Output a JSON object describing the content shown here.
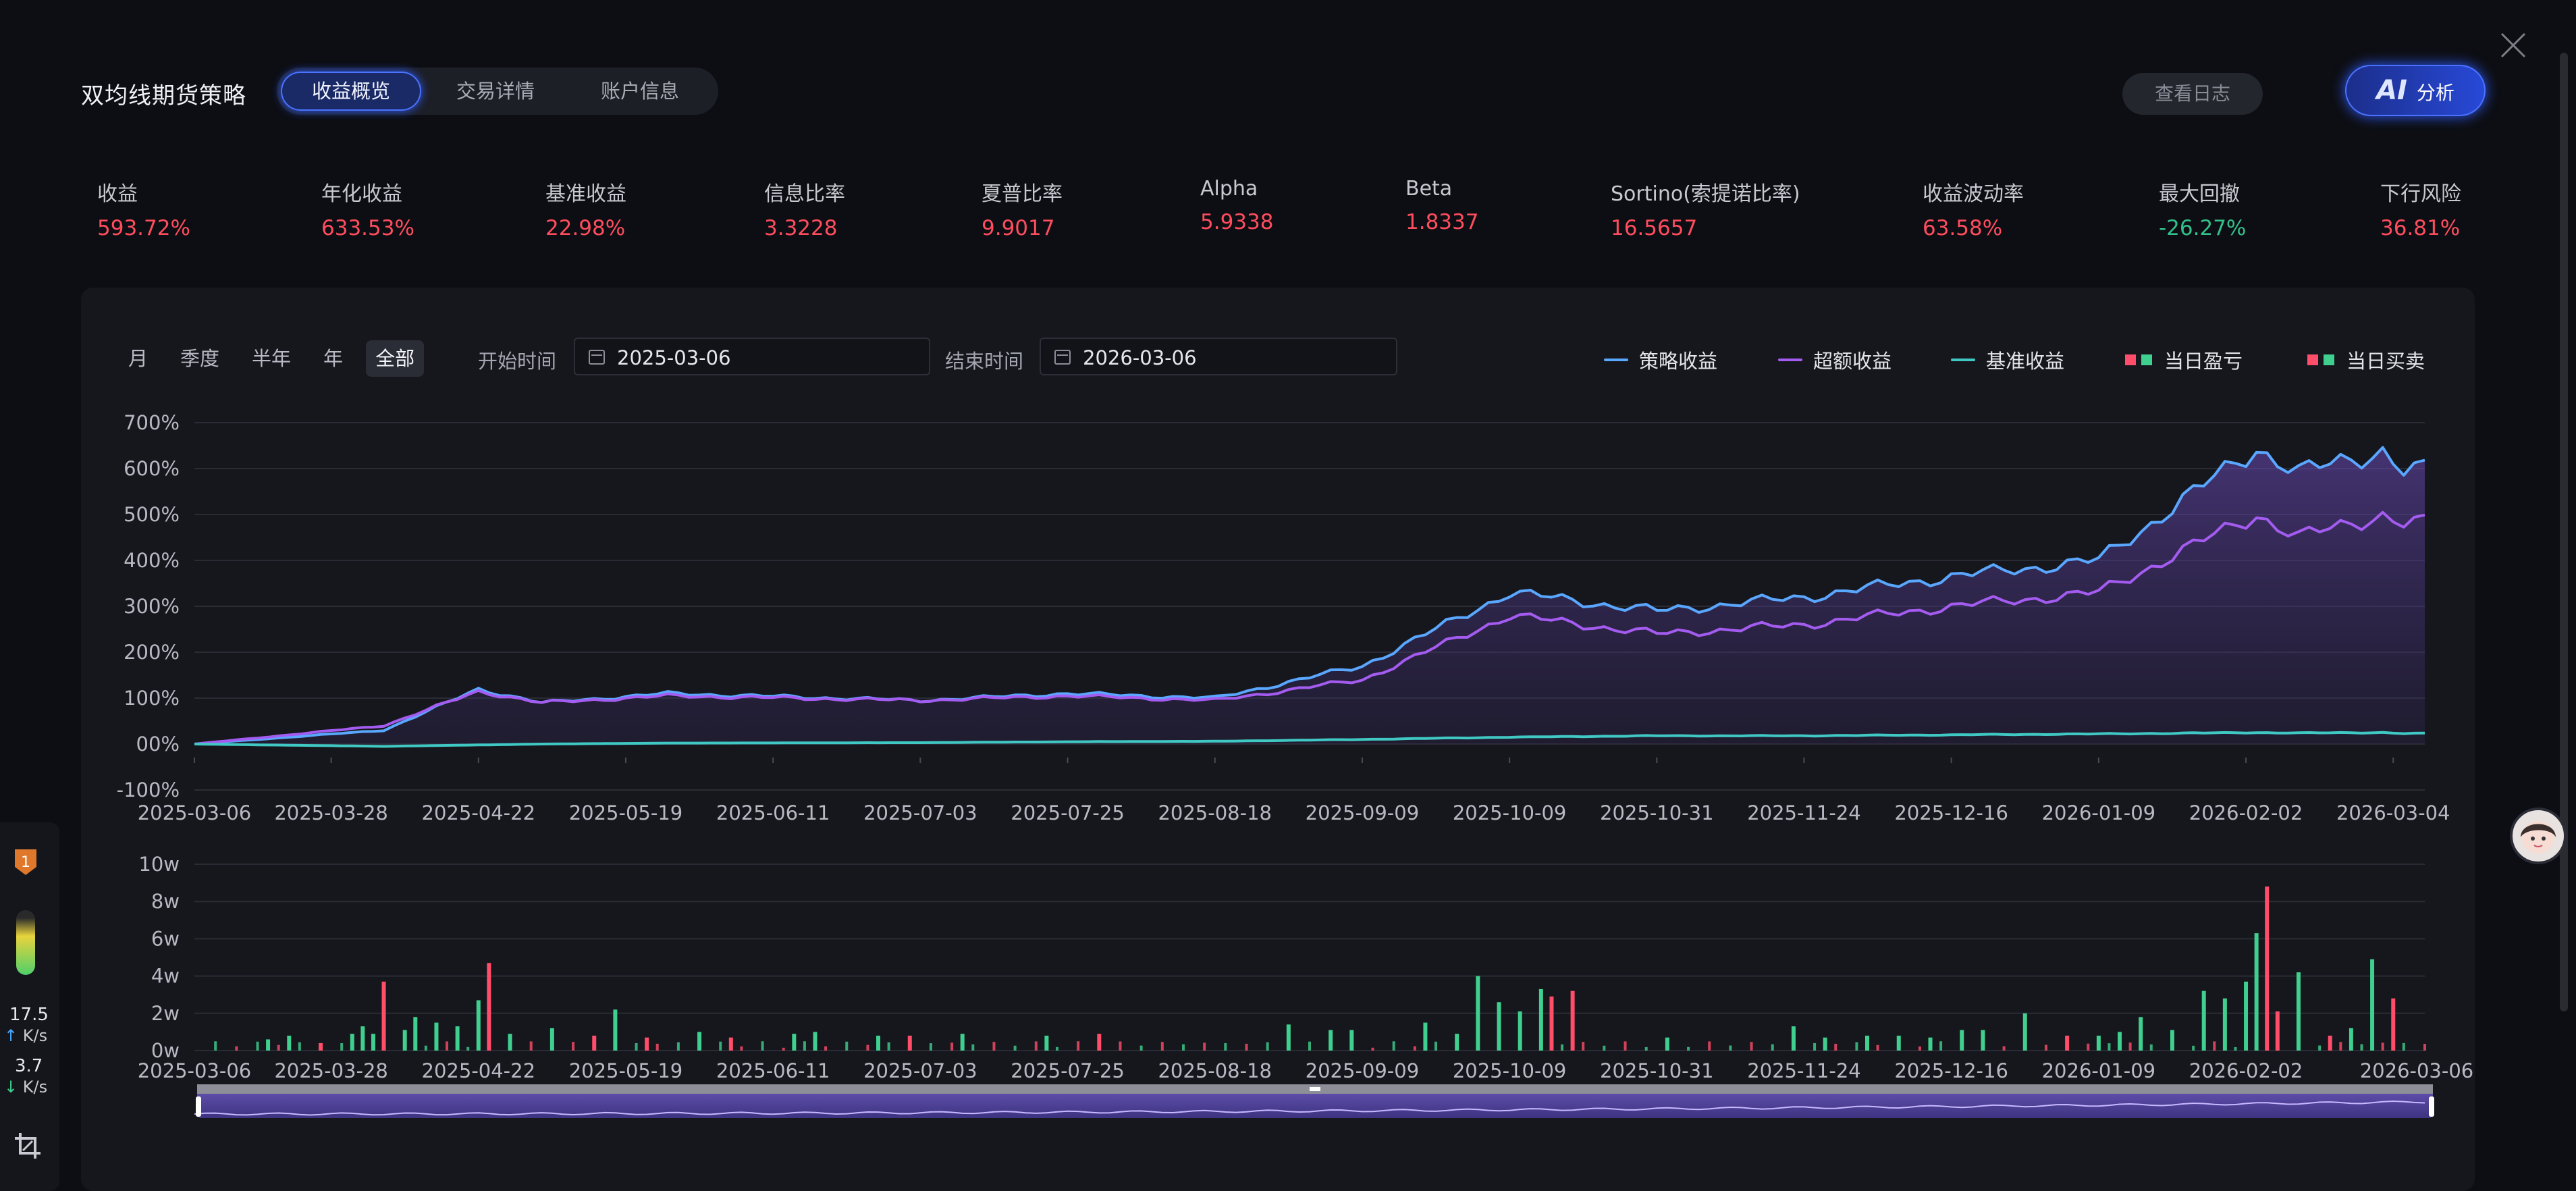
{
  "header": {
    "title": "双均线期货策略",
    "tabs": [
      {
        "label": "收益概览",
        "active": true
      },
      {
        "label": "交易详情",
        "active": false
      },
      {
        "label": "账户信息",
        "active": false
      }
    ],
    "log_button": "查看日志",
    "ai_button": {
      "icon_text": "AI",
      "label": "分析"
    }
  },
  "metrics": [
    {
      "label": "收益",
      "value": "593.72%"
    },
    {
      "label": "年化收益",
      "value": "633.53%"
    },
    {
      "label": "基准收益",
      "value": "22.98%"
    },
    {
      "label": "信息比率",
      "value": "3.3228"
    },
    {
      "label": "夏普比率",
      "value": "9.9017"
    },
    {
      "label": "Alpha",
      "value": "5.9338"
    },
    {
      "label": "Beta",
      "value": "1.8337"
    },
    {
      "label": "Sortino(索提诺比率)",
      "value": "16.5657"
    },
    {
      "label": "收益波动率",
      "value": "63.58%"
    },
    {
      "label": "最大回撤",
      "value": "-26.27%"
    },
    {
      "label": "下行风险",
      "value": "36.81%"
    }
  ],
  "filters": {
    "periods": [
      {
        "label": "月",
        "active": false
      },
      {
        "label": "季度",
        "active": false
      },
      {
        "label": "半年",
        "active": false
      },
      {
        "label": "年",
        "active": false
      },
      {
        "label": "全部",
        "active": true
      }
    ],
    "start_label": "开始时间",
    "start_value": "2025-03-06",
    "end_label": "结束时间",
    "end_value": "2026-03-06"
  },
  "legend": [
    {
      "label": "策略收益",
      "kind": "line",
      "color": "#5aa7ff"
    },
    {
      "label": "超额收益",
      "kind": "line",
      "color": "#a45cf0"
    },
    {
      "label": "基准收益",
      "kind": "line",
      "color": "#40c9c4"
    },
    {
      "label": "当日盈亏",
      "kind": "squares",
      "colors": [
        "#ff4d6a",
        "#3fcf8e"
      ]
    },
    {
      "label": "当日买卖",
      "kind": "squares",
      "colors": [
        "#ff4d6a",
        "#3fcf8e"
      ]
    }
  ],
  "sidebar": {
    "badge": "1",
    "upload_speed": "17.5",
    "download_speed": "3.7",
    "speed_unit": "K/s"
  },
  "chart_data": [
    {
      "type": "line",
      "yunit": "%",
      "ylim": [
        -100,
        700
      ],
      "yticks": [
        "700%",
        "600%",
        "500%",
        "400%",
        "300%",
        "200%",
        "100%",
        "00%",
        "-100%"
      ],
      "xticks": [
        "2025-03-06",
        "2025-03-28",
        "2025-04-22",
        "2025-05-19",
        "2025-06-11",
        "2025-07-03",
        "2025-07-25",
        "2025-08-18",
        "2025-09-09",
        "2025-10-09",
        "2025-10-31",
        "2025-11-24",
        "2025-12-16",
        "2026-01-09",
        "2026-02-02",
        "2026-03-04"
      ],
      "x_index": [
        0,
        13,
        27,
        41,
        55,
        69,
        83,
        97,
        111,
        125,
        139,
        153,
        167,
        181,
        195,
        209,
        212
      ],
      "series": [
        {
          "name": "策略收益",
          "color": "#5aa7ff",
          "values": [
            0,
            30,
            120,
            90,
            110,
            95,
            110,
            100,
            170,
            330,
            290,
            320,
            365,
            400,
            645,
            590,
            640,
            595,
            595
          ]
        },
        {
          "name": "超额收益",
          "color": "#a45cf0",
          "values": [
            0,
            40,
            115,
            90,
            105,
            95,
            105,
            95,
            140,
            280,
            240,
            260,
            300,
            330,
            500,
            450,
            500,
            480,
            480
          ]
        },
        {
          "name": "基准收益",
          "color": "#40c9c4",
          "values": [
            0,
            -5,
            -2,
            0,
            2,
            3,
            5,
            6,
            10,
            15,
            18,
            18,
            20,
            22,
            25,
            24,
            25,
            23,
            23
          ]
        }
      ],
      "series_x": [
        0,
        18,
        27,
        33,
        45,
        69,
        83,
        97,
        111,
        125,
        139,
        153,
        167,
        181,
        196,
        200,
        208,
        210,
        212
      ]
    },
    {
      "type": "bar",
      "yticks": [
        "10w",
        "8w",
        "6w",
        "4w",
        "2w",
        "0w"
      ],
      "ylim": [
        0,
        10
      ],
      "xticks": [
        "2025-03-06",
        "2025-03-28",
        "2025-04-22",
        "2025-05-19",
        "2025-06-11",
        "2025-07-03",
        "2025-07-25",
        "2025-08-18",
        "2025-09-09",
        "2025-10-09",
        "2025-10-31",
        "2025-11-24",
        "2025-12-16",
        "2026-01-09",
        "2026-02-02",
        "2026-03-06"
      ],
      "bars": [
        {
          "i": 7,
          "v": 0.6,
          "s": "g"
        },
        {
          "i": 9,
          "v": 0.8,
          "s": "g"
        },
        {
          "i": 12,
          "v": 0.4,
          "s": "r"
        },
        {
          "i": 15,
          "v": 0.9,
          "s": "g"
        },
        {
          "i": 16,
          "v": 1.3,
          "s": "g"
        },
        {
          "i": 17,
          "v": 0.9,
          "s": "g"
        },
        {
          "i": 18,
          "v": 3.7,
          "s": "r"
        },
        {
          "i": 20,
          "v": 1.1,
          "s": "g"
        },
        {
          "i": 21,
          "v": 1.8,
          "s": "g"
        },
        {
          "i": 23,
          "v": 1.5,
          "s": "g"
        },
        {
          "i": 25,
          "v": 1.3,
          "s": "g"
        },
        {
          "i": 27,
          "v": 2.7,
          "s": "g"
        },
        {
          "i": 28,
          "v": 4.7,
          "s": "r"
        },
        {
          "i": 30,
          "v": 0.9,
          "s": "g"
        },
        {
          "i": 34,
          "v": 1.2,
          "s": "g"
        },
        {
          "i": 38,
          "v": 0.8,
          "s": "r"
        },
        {
          "i": 40,
          "v": 2.2,
          "s": "g"
        },
        {
          "i": 43,
          "v": 0.7,
          "s": "r"
        },
        {
          "i": 48,
          "v": 1.0,
          "s": "g"
        },
        {
          "i": 51,
          "v": 0.7,
          "s": "r"
        },
        {
          "i": 57,
          "v": 0.9,
          "s": "g"
        },
        {
          "i": 59,
          "v": 1.0,
          "s": "g"
        },
        {
          "i": 65,
          "v": 0.8,
          "s": "g"
        },
        {
          "i": 68,
          "v": 0.8,
          "s": "r"
        },
        {
          "i": 73,
          "v": 0.9,
          "s": "g"
        },
        {
          "i": 81,
          "v": 0.8,
          "s": "g"
        },
        {
          "i": 86,
          "v": 0.9,
          "s": "r"
        },
        {
          "i": 104,
          "v": 1.4,
          "s": "g"
        },
        {
          "i": 108,
          "v": 1.1,
          "s": "g"
        },
        {
          "i": 110,
          "v": 1.1,
          "s": "g"
        },
        {
          "i": 117,
          "v": 1.5,
          "s": "g"
        },
        {
          "i": 120,
          "v": 0.9,
          "s": "g"
        },
        {
          "i": 122,
          "v": 4.0,
          "s": "g"
        },
        {
          "i": 124,
          "v": 2.6,
          "s": "g"
        },
        {
          "i": 126,
          "v": 2.1,
          "s": "g"
        },
        {
          "i": 128,
          "v": 3.3,
          "s": "g"
        },
        {
          "i": 129,
          "v": 2.9,
          "s": "r"
        },
        {
          "i": 131,
          "v": 3.2,
          "s": "r"
        },
        {
          "i": 140,
          "v": 0.7,
          "s": "g"
        },
        {
          "i": 152,
          "v": 1.3,
          "s": "g"
        },
        {
          "i": 155,
          "v": 0.7,
          "s": "g"
        },
        {
          "i": 159,
          "v": 0.8,
          "s": "g"
        },
        {
          "i": 162,
          "v": 0.8,
          "s": "g"
        },
        {
          "i": 165,
          "v": 0.7,
          "s": "g"
        },
        {
          "i": 168,
          "v": 1.1,
          "s": "g"
        },
        {
          "i": 170,
          "v": 1.1,
          "s": "g"
        },
        {
          "i": 174,
          "v": 2.0,
          "s": "g"
        },
        {
          "i": 178,
          "v": 0.8,
          "s": "r"
        },
        {
          "i": 181,
          "v": 0.8,
          "s": "g"
        },
        {
          "i": 183,
          "v": 1.0,
          "s": "g"
        },
        {
          "i": 185,
          "v": 1.8,
          "s": "g"
        },
        {
          "i": 188,
          "v": 1.1,
          "s": "g"
        },
        {
          "i": 191,
          "v": 3.2,
          "s": "g"
        },
        {
          "i": 193,
          "v": 2.8,
          "s": "g"
        },
        {
          "i": 195,
          "v": 3.7,
          "s": "g"
        },
        {
          "i": 196,
          "v": 6.3,
          "s": "g"
        },
        {
          "i": 197,
          "v": 8.8,
          "s": "r"
        },
        {
          "i": 198,
          "v": 2.1,
          "s": "r"
        },
        {
          "i": 200,
          "v": 4.2,
          "s": "g"
        },
        {
          "i": 203,
          "v": 0.8,
          "s": "r"
        },
        {
          "i": 205,
          "v": 1.2,
          "s": "g"
        },
        {
          "i": 207,
          "v": 4.9,
          "s": "g"
        },
        {
          "i": 209,
          "v": 2.8,
          "s": "r"
        }
      ]
    }
  ]
}
